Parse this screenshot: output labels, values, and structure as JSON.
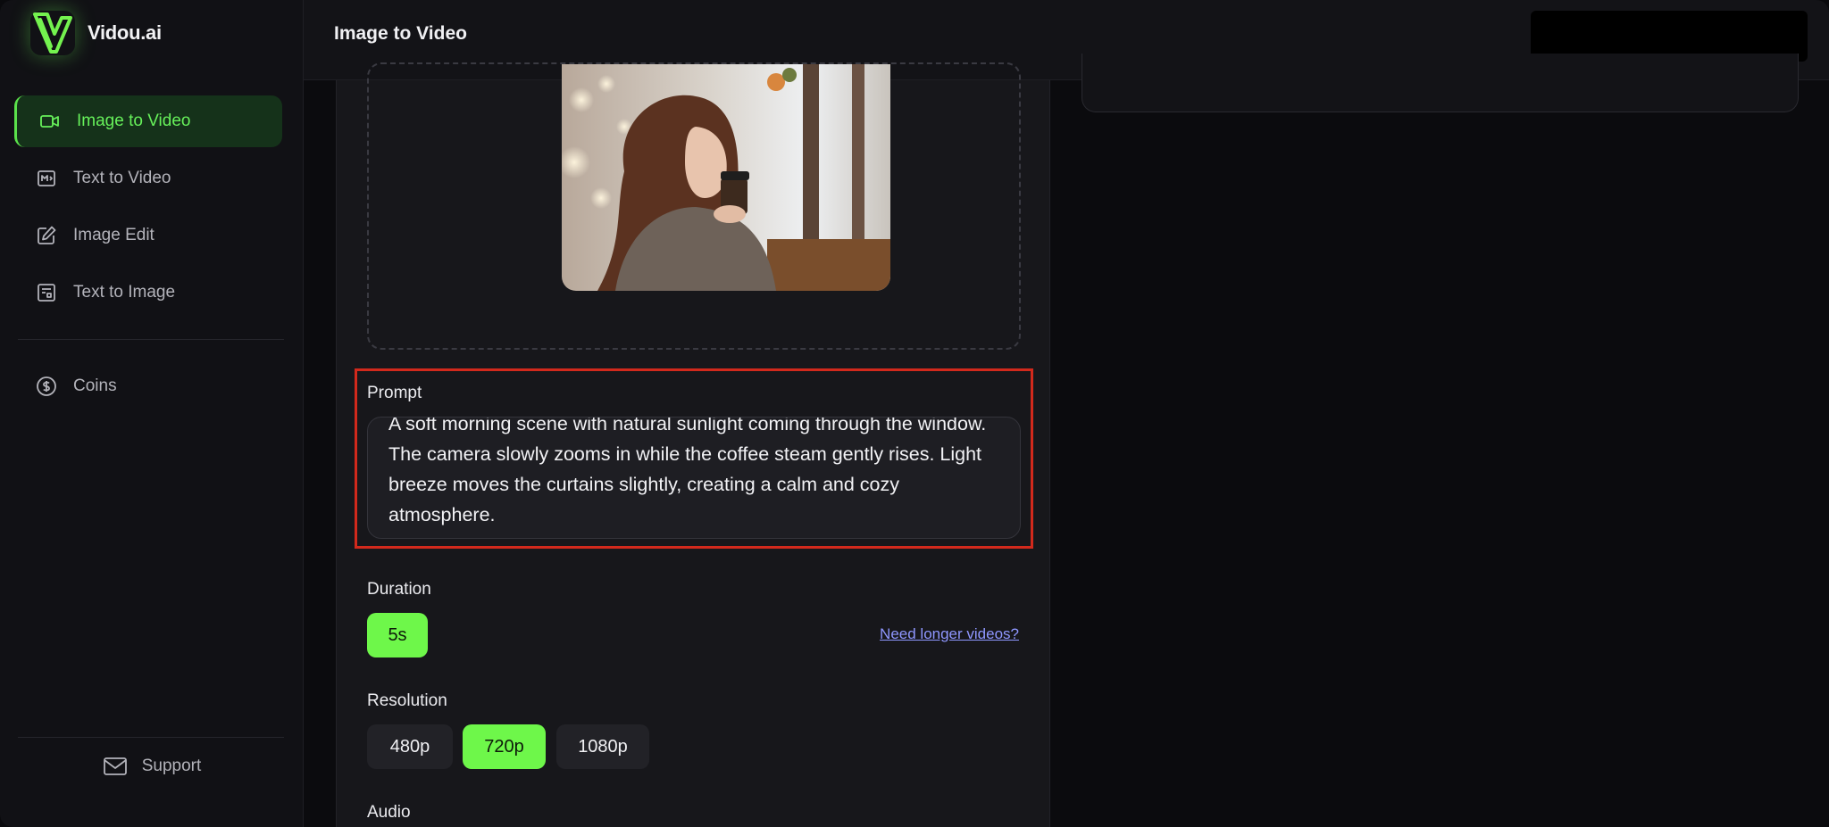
{
  "brand": {
    "name": "Vidou.ai"
  },
  "header": {
    "title": "Image to Video"
  },
  "sidebar": {
    "items": [
      {
        "label": "Image to Video",
        "icon": "video-camera-icon",
        "active": true
      },
      {
        "label": "Text to Video",
        "icon": "film-frame-icon",
        "active": false
      },
      {
        "label": "Image Edit",
        "icon": "edit-pencil-icon",
        "active": false
      },
      {
        "label": "Text to Image",
        "icon": "image-text-icon",
        "active": false
      }
    ],
    "coins": {
      "label": "Coins",
      "icon": "dollar-circle-icon"
    },
    "support": {
      "label": "Support",
      "icon": "mail-icon"
    }
  },
  "form": {
    "prompt": {
      "label": "Prompt",
      "value": "A soft morning scene with natural sunlight coming through the window. The camera slowly zooms in while the coffee steam gently rises. Light breeze moves the curtains slightly, creating a calm and cozy atmosphere."
    },
    "duration": {
      "label": "Duration",
      "options": [
        "5s"
      ],
      "selected": "5s",
      "link": "Need longer videos?"
    },
    "resolution": {
      "label": "Resolution",
      "options": [
        "480p",
        "720p",
        "1080p"
      ],
      "selected": "720p"
    },
    "audio": {
      "label": "Audio"
    }
  },
  "colors": {
    "accent": "#6ef74a",
    "highlight": "#d2291c",
    "link": "#8f97ff"
  }
}
